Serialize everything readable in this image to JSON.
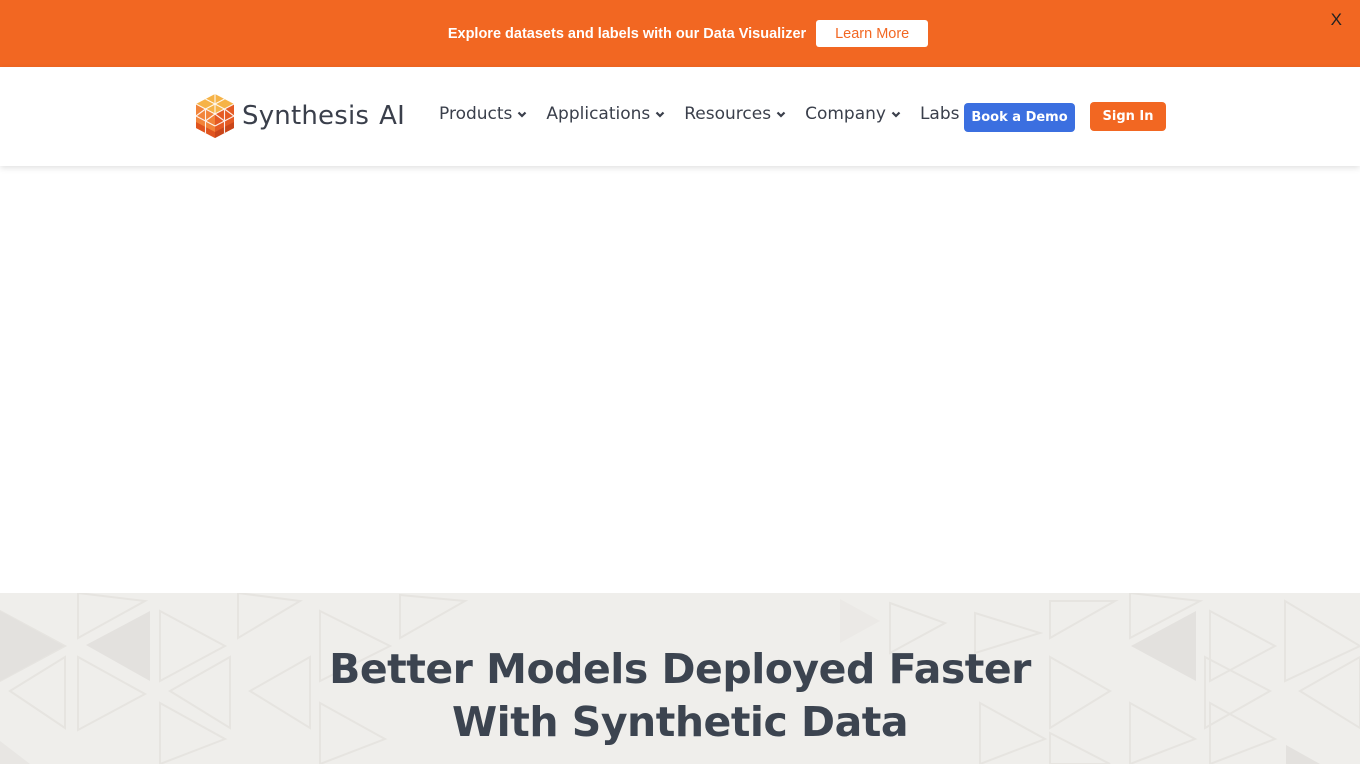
{
  "announcement": {
    "text": "Explore datasets and labels with our Data Visualizer",
    "button_label": "Learn More",
    "close_label": "X"
  },
  "header": {
    "logo_name": "Synthesis",
    "logo_suffix": "AI",
    "nav": [
      {
        "label": "Products",
        "has_dropdown": true
      },
      {
        "label": "Applications",
        "has_dropdown": true
      },
      {
        "label": "Resources",
        "has_dropdown": true
      },
      {
        "label": "Company",
        "has_dropdown": true
      },
      {
        "label": "Labs",
        "has_dropdown": false
      }
    ],
    "demo_button": "Book a Demo",
    "signin_button": "Sign In"
  },
  "hero": {
    "title_line1": "Better Models Deployed Faster",
    "title_line2": "With Synthetic Data"
  },
  "colors": {
    "brand_orange": "#f26722",
    "demo_blue": "#3b6fe0",
    "text_dark": "#3c4450",
    "hero_bg": "#efeeeb"
  }
}
